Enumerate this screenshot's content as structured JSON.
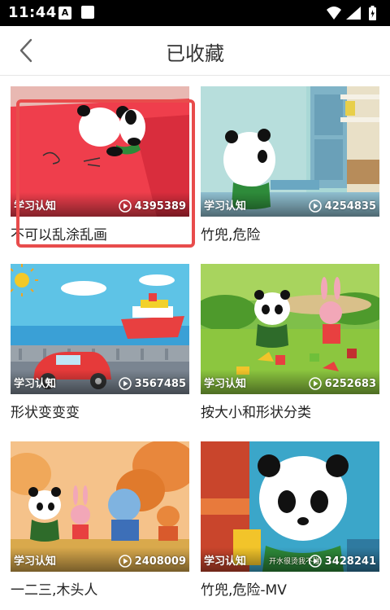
{
  "status_bar": {
    "time": "11:44",
    "notification_icons": [
      "a-app-icon",
      "square-app-icon"
    ],
    "system_icons": [
      "wifi-icon",
      "signal-icon",
      "battery-icon"
    ]
  },
  "header": {
    "back_icon": "chevron-left-icon",
    "title": "已收藏"
  },
  "videos": [
    {
      "title": "不可以乱涂乱画",
      "category": "学习认知",
      "plays": "4395389"
    },
    {
      "title": "竹兜,危险",
      "category": "学习认知",
      "plays": "4254835"
    },
    {
      "title": "形状变变变",
      "category": "学习认知",
      "plays": "3567485"
    },
    {
      "title": "按大小和形状分类",
      "category": "学习认知",
      "plays": "6252683"
    },
    {
      "title": "一二三,木头人",
      "category": "学习认知",
      "plays": "2408009"
    },
    {
      "title": "竹兜,危险-MV",
      "category": "学习认知",
      "plays": "3428241",
      "caption": "开水很烫我不碰"
    }
  ],
  "colors": {
    "highlight": "#e84c4c",
    "title_text": "#333333",
    "status_bar": "#000000"
  }
}
